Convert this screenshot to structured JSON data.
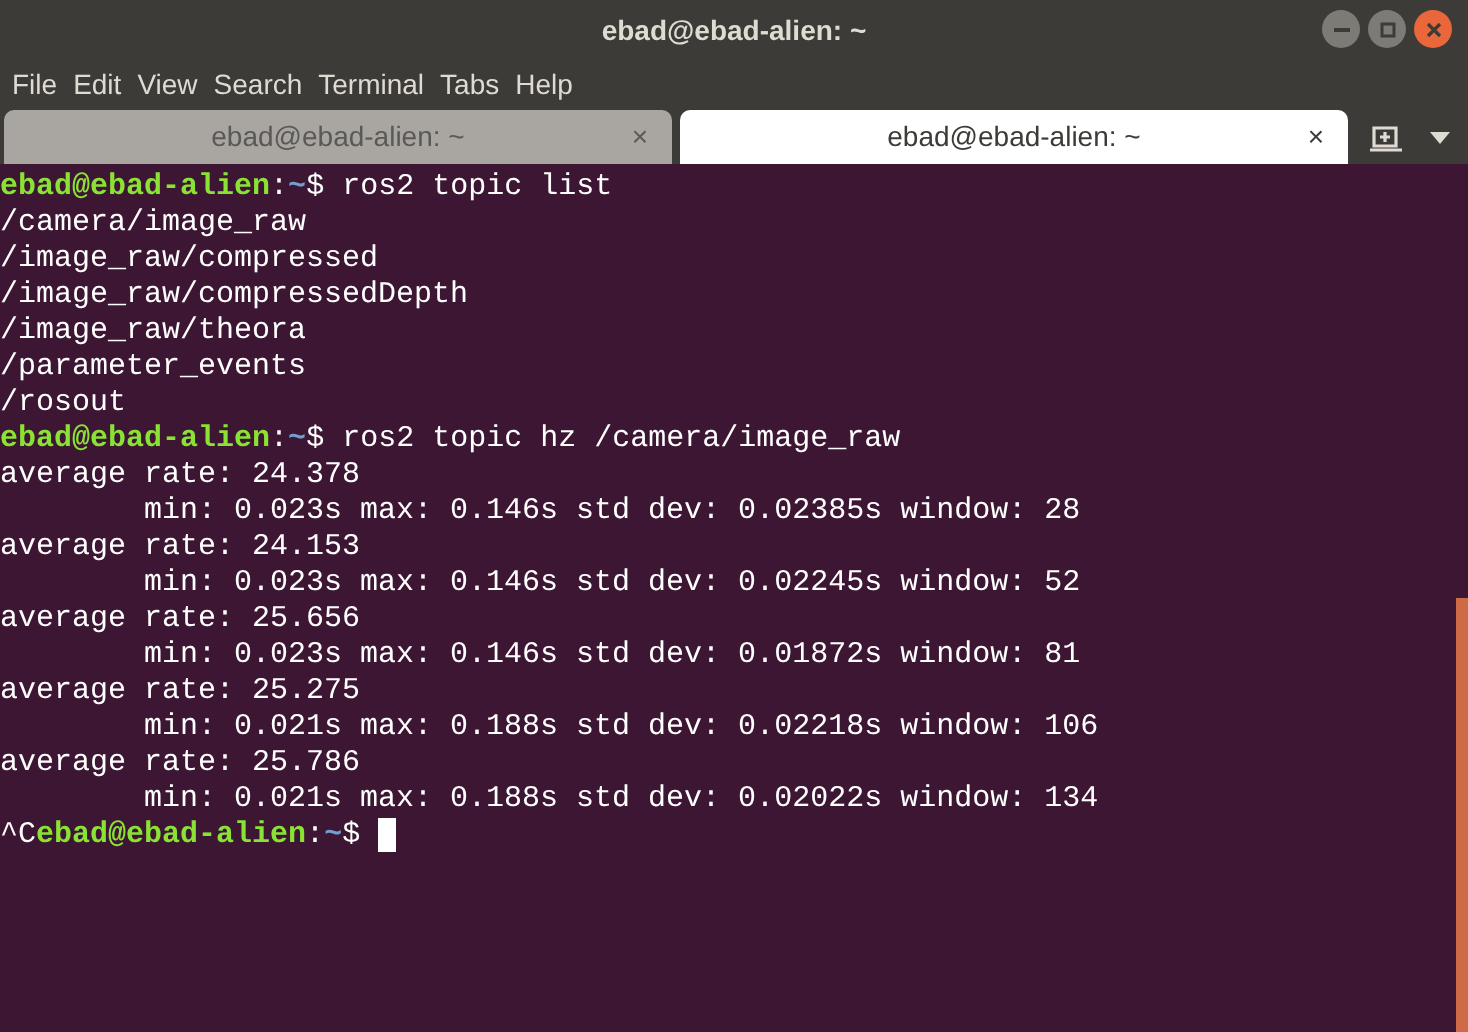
{
  "window": {
    "title": "ebad@ebad-alien: ~"
  },
  "menu": [
    "File",
    "Edit",
    "View",
    "Search",
    "Terminal",
    "Tabs",
    "Help"
  ],
  "tabs": [
    {
      "label": "ebad@ebad-alien: ~",
      "close": "×",
      "selected": false
    },
    {
      "label": "ebad@ebad-alien: ~",
      "close": "×",
      "selected": true
    }
  ],
  "terminal": {
    "lines": [
      {
        "kind": "prompt",
        "user": "ebad@ebad-alien",
        "sep": ":",
        "path": "~",
        "symbol": "$",
        "command": "ros2 topic list",
        "cursor": false
      },
      {
        "kind": "output",
        "text": "/camera/image_raw"
      },
      {
        "kind": "output",
        "text": "/image_raw/compressed"
      },
      {
        "kind": "output",
        "text": "/image_raw/compressedDepth"
      },
      {
        "kind": "output",
        "text": "/image_raw/theora"
      },
      {
        "kind": "output",
        "text": "/parameter_events"
      },
      {
        "kind": "output",
        "text": "/rosout"
      },
      {
        "kind": "prompt",
        "user": "ebad@ebad-alien",
        "sep": ":",
        "path": "~",
        "symbol": "$",
        "command": "ros2 topic hz /camera/image_raw",
        "cursor": false
      },
      {
        "kind": "output",
        "text": "average rate: 24.378"
      },
      {
        "kind": "output",
        "text": "        min: 0.023s max: 0.146s std dev: 0.02385s window: 28"
      },
      {
        "kind": "output",
        "text": "average rate: 24.153"
      },
      {
        "kind": "output",
        "text": "        min: 0.023s max: 0.146s std dev: 0.02245s window: 52"
      },
      {
        "kind": "output",
        "text": "average rate: 25.656"
      },
      {
        "kind": "output",
        "text": "        min: 0.023s max: 0.146s std dev: 0.01872s window: 81"
      },
      {
        "kind": "output",
        "text": "average rate: 25.275"
      },
      {
        "kind": "output",
        "text": "        min: 0.021s max: 0.188s std dev: 0.02218s window: 106"
      },
      {
        "kind": "output",
        "text": "average rate: 25.786"
      },
      {
        "kind": "output",
        "text": "        min: 0.021s max: 0.188s std dev: 0.02022s window: 134"
      },
      {
        "kind": "prompt",
        "prefix": "^C",
        "user": "ebad@ebad-alien",
        "sep": ":",
        "path": "~",
        "symbol": "$",
        "cursor": true
      }
    ]
  }
}
